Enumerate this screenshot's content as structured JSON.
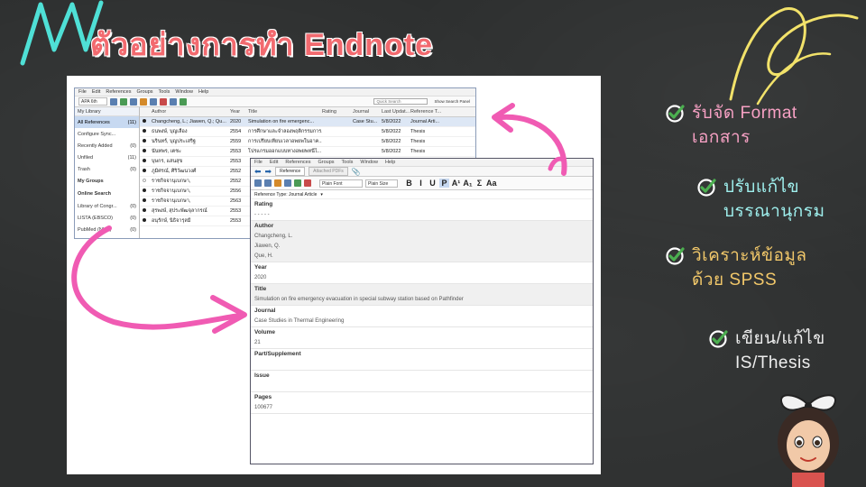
{
  "page": {
    "title": "ตัวอย่างการทำ Endnote"
  },
  "main_window": {
    "menu": [
      "File",
      "Edit",
      "References",
      "Groups",
      "Tools",
      "Window",
      "Help"
    ],
    "style_select": "APA 6th",
    "search_placeholder": "Quick Search",
    "show_search": "Show Search Panel",
    "sidebar_header": "My Library",
    "sidebar_items": [
      {
        "label": "All References",
        "count": "(11)",
        "selected": true
      },
      {
        "label": "Configure Sync...",
        "count": ""
      },
      {
        "label": "Recently Added",
        "count": "(0)"
      },
      {
        "label": "Unfiled",
        "count": "(11)"
      },
      {
        "label": "Trash",
        "count": "(0)"
      }
    ],
    "groups_label": "My Groups",
    "online_label": "Online Search",
    "online_items": [
      {
        "label": "Library of Congr...",
        "count": "(0)"
      },
      {
        "label": "LISTA (EBSCO)",
        "count": "(0)"
      },
      {
        "label": "PubMed (NLM)",
        "count": "(0)"
      }
    ],
    "columns": [
      "Author",
      "Year",
      "Title",
      "Rating",
      "Journal",
      "Last Updat...",
      "Reference T..."
    ],
    "rows": [
      {
        "author": "Changcheng, L.; Jiawen, Q.; Qu...",
        "year": "2020",
        "title": "Simulation on fire emergenc...",
        "rating": "",
        "journal": "Case Stu...",
        "updated": "5/8/2022",
        "type": "Journal Arti..."
      },
      {
        "author": "ธนพงษ์, บุญเลื่อง",
        "year": "2554",
        "title": "การศึกษาและจำลองพฤติกรรมการ...",
        "rating": "",
        "journal": "",
        "updated": "5/8/2022",
        "type": "Thesis"
      },
      {
        "author": "นรินทร์, บุญประเสริฐ",
        "year": "2559",
        "title": "การเปรียบเทียบเวลาอพยพในอาค...",
        "rating": "",
        "journal": "",
        "updated": "5/8/2022",
        "type": "Thesis"
      },
      {
        "author": "นันทพร, เตชะ",
        "year": "2553",
        "title": "โปรแกรมออกแบบทางอพยพหนีไ...",
        "rating": "",
        "journal": "",
        "updated": "5/8/2022",
        "type": "Thesis"
      },
      {
        "author": "บุษกร, แสนสุข",
        "year": "2553",
        "title": "",
        "rating": "",
        "journal": "",
        "updated": "",
        "type": ""
      },
      {
        "author": "ภูมิศรณ์, ศิริวัฒนวงศ์",
        "year": "2552",
        "title": "",
        "rating": "",
        "journal": "",
        "updated": "",
        "type": ""
      },
      {
        "author": "ราชกิจจานุเบกษา,",
        "year": "2552",
        "title": "",
        "rating": "",
        "journal": "",
        "updated": "",
        "type": ""
      },
      {
        "author": "ราชกิจจานุเบกษา,",
        "year": "2556",
        "title": "",
        "rating": "",
        "journal": "",
        "updated": "",
        "type": ""
      },
      {
        "author": "ราชกิจจานุเบกษา,",
        "year": "2563",
        "title": "",
        "rating": "",
        "journal": "",
        "updated": "",
        "type": ""
      },
      {
        "author": "สุรพงษ์, สุประพัฒจุลากรณ์",
        "year": "2553",
        "title": "",
        "rating": "",
        "journal": "",
        "updated": "",
        "type": ""
      },
      {
        "author": "อนุรักษ์, นิธิจารุลมี",
        "year": "2553",
        "title": "",
        "rating": "",
        "journal": "",
        "updated": "",
        "type": ""
      }
    ]
  },
  "ref_window": {
    "menu": [
      "File",
      "Edit",
      "References",
      "Groups",
      "Tools",
      "Window",
      "Help"
    ],
    "tab_reference": "Reference",
    "tab_pdfs": "Attached PDFs",
    "font_select": "Plain Font",
    "size_select": "Plain Size",
    "format_buttons": [
      "B",
      "I",
      "U",
      "P",
      "A¹",
      "A₁",
      "Σ",
      "Aa"
    ],
    "ref_type_label": "Reference Type: Journal Article",
    "fields": [
      {
        "label": "Rating",
        "values": [
          "- - - - -"
        ],
        "grey": false
      },
      {
        "label": "Author",
        "values": [
          "Changcheng, L.",
          "Jiawen, Q.",
          "Que, H."
        ],
        "grey": true
      },
      {
        "label": "Year",
        "values": [
          "2020"
        ],
        "grey": false
      },
      {
        "label": "Title",
        "values": [
          "Simulation on fire emergency evacuation in special subway station based on Pathfinder"
        ],
        "grey": true
      },
      {
        "label": "Journal",
        "values": [
          "Case Studies in Thermal Engineering"
        ],
        "grey": false
      },
      {
        "label": "Volume",
        "values": [
          "21"
        ],
        "grey": false
      },
      {
        "label": "Part/Supplement",
        "values": [
          ""
        ],
        "grey": false
      },
      {
        "label": "Issue",
        "values": [
          ""
        ],
        "grey": false
      },
      {
        "label": "Pages",
        "values": [
          "100677"
        ],
        "grey": false
      }
    ]
  },
  "services": [
    {
      "lines": [
        "รับจัด Format",
        "เอกสาร"
      ],
      "color": "pink"
    },
    {
      "lines": [
        "ปรับแก้ไข",
        "บรรณานุกรม"
      ],
      "color": "cyan"
    },
    {
      "lines": [
        "วิเคราะห์ข้อมูล",
        "ด้วย SPSS"
      ],
      "color": "orange"
    },
    {
      "lines": [
        "เขียน/แก้ไข",
        "IS/Thesis"
      ],
      "color": "white"
    }
  ],
  "colors": {
    "title": "#f26a6f",
    "arrow": "#f05bb3",
    "check": "#4caf50",
    "deco_cyan": "#4fe0d6",
    "deco_yellow": "#f2e26a"
  }
}
